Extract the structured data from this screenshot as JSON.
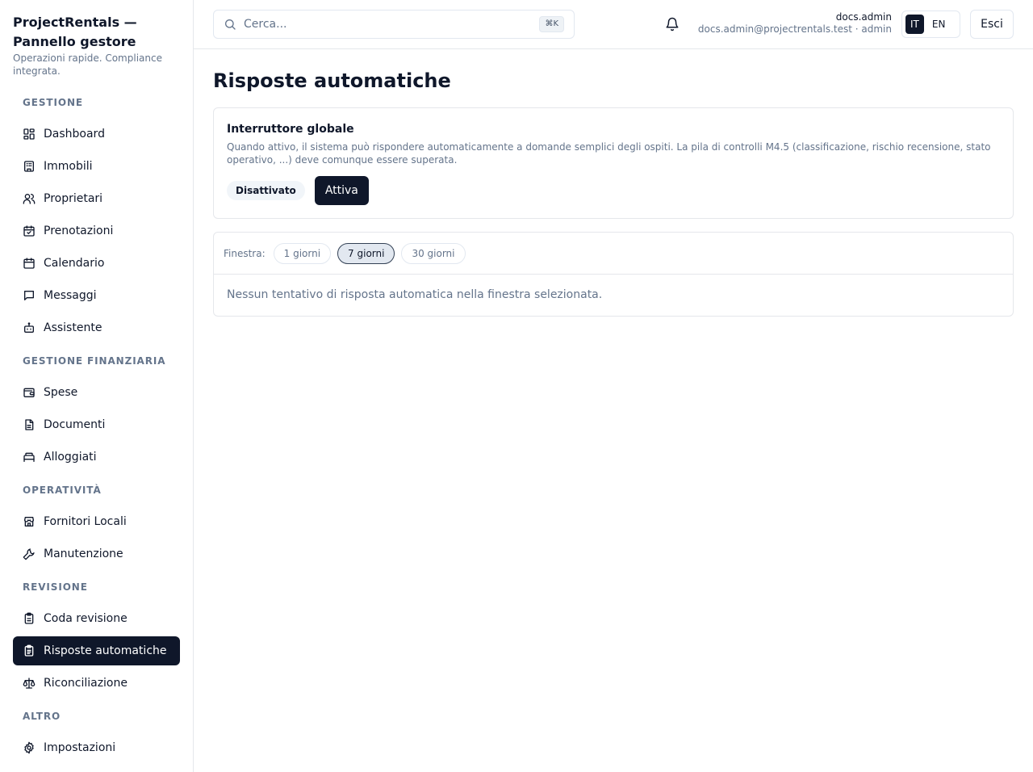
{
  "brand": {
    "title": "ProjectRentals — Pannello gestore",
    "subtitle": "Operazioni rapide. Compliance integrata."
  },
  "sidebar": {
    "sections": [
      {
        "title": "GESTIONE",
        "items": [
          {
            "label": "Dashboard",
            "icon": "dashboard-icon"
          },
          {
            "label": "Immobili",
            "icon": "building-icon"
          },
          {
            "label": "Proprietari",
            "icon": "users-icon"
          },
          {
            "label": "Prenotazioni",
            "icon": "calendar-check-icon"
          },
          {
            "label": "Calendario",
            "icon": "calendar-icon"
          },
          {
            "label": "Messaggi",
            "icon": "message-icon"
          },
          {
            "label": "Assistente",
            "icon": "bot-icon"
          }
        ]
      },
      {
        "title": "GESTIONE FINANZIARIA",
        "items": [
          {
            "label": "Spese",
            "icon": "wallet-icon"
          },
          {
            "label": "Documenti",
            "icon": "document-icon"
          },
          {
            "label": "Alloggiati",
            "icon": "bed-icon"
          }
        ]
      },
      {
        "title": "OPERATIVITÀ",
        "items": [
          {
            "label": "Fornitori Locali",
            "icon": "store-icon"
          },
          {
            "label": "Manutenzione",
            "icon": "wrench-icon"
          }
        ]
      },
      {
        "title": "REVISIONE",
        "items": [
          {
            "label": "Coda revisione",
            "icon": "clipboard-icon"
          },
          {
            "label": "Risposte automatiche",
            "icon": "clipboard-list-icon",
            "active": true
          },
          {
            "label": "Riconciliazione",
            "icon": "scale-icon"
          }
        ]
      },
      {
        "title": "ALTRO",
        "items": [
          {
            "label": "Impostazioni",
            "icon": "gear-icon"
          }
        ]
      }
    ]
  },
  "header": {
    "search_placeholder": "Cerca...",
    "search_shortcut": "⌘K",
    "user_name": "docs.admin",
    "user_detail": "docs.admin@projectrentals.test · admin",
    "lang_it": "IT",
    "lang_en": "EN",
    "active_lang": "IT",
    "logout_label": "Esci"
  },
  "main": {
    "title": "Risposte automatiche",
    "switch_card": {
      "title": "Interruttore globale",
      "description": "Quando attivo, il sistema può rispondere automaticamente a domande semplici degli ospiti. La pila di controlli M4.5 (classificazione, rischio recensione, stato operativo, ...) deve comunque essere superata.",
      "status": "Disattivato",
      "action_label": "Attiva"
    },
    "window_panel": {
      "label": "Finestra:",
      "options": [
        "1 giorni",
        "7 giorni",
        "30 giorni"
      ],
      "selected": "7 giorni",
      "empty_message": "Nessun tentativo di risposta automatica nella finestra selezionata."
    }
  },
  "colors": {
    "primary": "#0f172a",
    "muted": "#64748b",
    "border": "#e5e7eb"
  }
}
